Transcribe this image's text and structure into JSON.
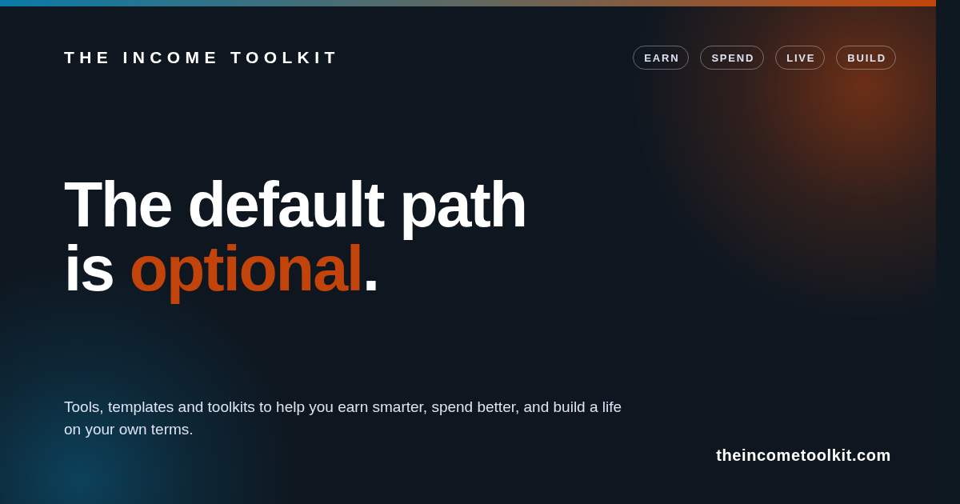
{
  "brand": {
    "title": "THE INCOME TOOLKIT"
  },
  "nav": [
    {
      "label": "EARN"
    },
    {
      "label": "SPEND"
    },
    {
      "label": "LIVE"
    },
    {
      "label": "BUILD"
    }
  ],
  "headline": {
    "line_1": "The default path",
    "line_2": [
      {
        "text": "is ",
        "accent": false
      },
      {
        "text": "optional",
        "accent": true
      },
      {
        "text": ".",
        "accent": false
      }
    ]
  },
  "subtitle": "Tools, templates and toolkits to help you earn smarter, spend better, and build a life on your own terms.",
  "domain": "theincometoolkit.com"
}
